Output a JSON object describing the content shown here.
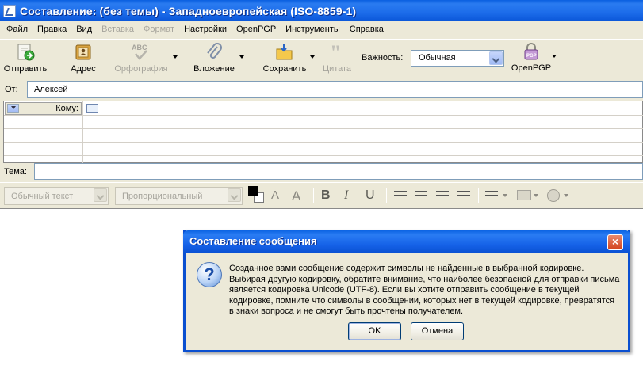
{
  "window": {
    "title": "Составление: (без темы) - Западноевропейская (ISO-8859-1)"
  },
  "menu": {
    "items": [
      {
        "label": "Файл",
        "disabled": false
      },
      {
        "label": "Правка",
        "disabled": false
      },
      {
        "label": "Вид",
        "disabled": false
      },
      {
        "label": "Вставка",
        "disabled": true
      },
      {
        "label": "Формат",
        "disabled": true
      },
      {
        "label": "Настройки",
        "disabled": false
      },
      {
        "label": "OpenPGP",
        "disabled": false
      },
      {
        "label": "Инструменты",
        "disabled": false
      },
      {
        "label": "Справка",
        "disabled": false
      }
    ]
  },
  "toolbar": {
    "send": "Отправить",
    "address": "Адрес",
    "spelling": "Орфография",
    "attach": "Вложение",
    "save": "Сохранить",
    "quote": "Цитата",
    "importance_label": "Важность:",
    "importance_value": "Обычная",
    "openpgp": "OpenPGP"
  },
  "header": {
    "from_label": "От:",
    "from_value": "Алексей",
    "to_label": "Кому:",
    "subject_label": "Тема:",
    "subject_value": ""
  },
  "format_bar": {
    "paragraph_style": "Обычный текст",
    "font": "Пропорциональный",
    "colors": {
      "foreground": "#000000",
      "background": "#ffffff"
    }
  },
  "dialog": {
    "title": "Составление сообщения",
    "message": "Созданное вами сообщение содержит символы не найденные в выбранной кодировке. Выбирая другую кодировку, обратите внимание, что наиболее безопасной для отправки письма является кодировка Unicode (UTF-8). Если вы хотите отправить сообщение в текущей кодировке, помните что символы в сообщении, которых нет в текущей кодировке, превратятся в знаки вопроса и не смогут быть прочтены получателем.",
    "ok": "OK",
    "cancel": "Отмена",
    "icon": "question-icon"
  },
  "colors": {
    "titlebar": "#0a5fe0",
    "face": "#ece9d8",
    "close_button": "#d3431e"
  }
}
